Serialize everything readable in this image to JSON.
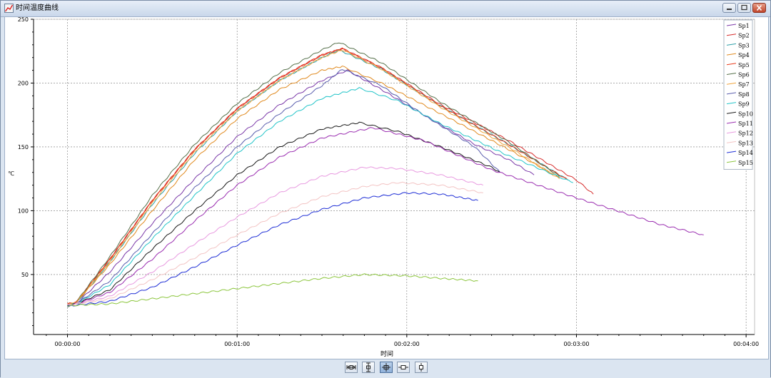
{
  "window": {
    "title": "时间温度曲线"
  },
  "toolbar": {
    "buttons": [
      "fit-horizontal",
      "fit-vertical",
      "fit-both",
      "zoom-horizontal",
      "zoom-vertical"
    ],
    "active": "fit-both"
  },
  "chart_data": {
    "type": "line",
    "title": "",
    "xlabel": "时间",
    "ylabel": "℃",
    "xlim": [
      -0.2,
      4.05
    ],
    "ylim": [
      3,
      250
    ],
    "x_unit": "minutes",
    "x_ticks": [
      0,
      1,
      2,
      3,
      4
    ],
    "x_tick_labels": [
      "00:00:00",
      "00:01:00",
      "00:02:00",
      "00:03:00",
      "00:04:00"
    ],
    "y_ticks": [
      50,
      100,
      150,
      200,
      250
    ],
    "y_tick_labels": [
      "50",
      "100",
      "150",
      "200",
      "250"
    ],
    "grid": true,
    "legend_position": "top-right",
    "series": [
      {
        "name": "Sp1",
        "color": "#7a38a8",
        "x": [
          0,
          0.05,
          0.25,
          0.5,
          0.75,
          1.0,
          1.25,
          1.5,
          1.65,
          1.85,
          2.1,
          2.4,
          2.6,
          2.75
        ],
        "y": [
          26,
          27,
          52,
          90,
          125,
          158,
          183,
          202,
          210,
          195,
          175,
          152,
          140,
          128
        ]
      },
      {
        "name": "Sp2",
        "color": "#d62b2b",
        "x": [
          0,
          0.05,
          0.25,
          0.5,
          0.75,
          1.0,
          1.25,
          1.5,
          1.62,
          1.85,
          2.2,
          2.6,
          3.0,
          3.1
        ],
        "y": [
          27,
          28,
          62,
          108,
          148,
          180,
          204,
          222,
          227,
          212,
          183,
          155,
          124,
          113
        ]
      },
      {
        "name": "Sp3",
        "color": "#2c9fa8",
        "x": [
          0,
          0.05,
          0.25,
          0.5,
          0.75,
          1.0,
          1.25,
          1.5,
          1.6,
          1.85,
          2.2,
          2.6,
          2.95
        ],
        "y": [
          26,
          27,
          60,
          105,
          145,
          178,
          202,
          220,
          226,
          211,
          182,
          152,
          124
        ]
      },
      {
        "name": "Sp4",
        "color": "#e08a1f",
        "x": [
          0,
          0.05,
          0.25,
          0.5,
          0.75,
          1.0,
          1.25,
          1.5,
          1.62,
          1.85,
          2.2,
          2.6,
          2.9
        ],
        "y": [
          26,
          28,
          58,
          100,
          140,
          172,
          195,
          210,
          213,
          200,
          176,
          148,
          126
        ]
      },
      {
        "name": "Sp5",
        "color": "#e83a1a",
        "x": [
          0,
          0.05,
          0.25,
          0.5,
          0.75,
          1.0,
          1.25,
          1.5,
          1.62,
          1.85,
          2.2,
          2.6,
          2.95
        ],
        "y": [
          27,
          28,
          62,
          108,
          148,
          180,
          204,
          222,
          227,
          212,
          182,
          152,
          124
        ]
      },
      {
        "name": "Sp6",
        "color": "#55704a",
        "x": [
          0,
          0.05,
          0.25,
          0.5,
          0.75,
          1.0,
          1.25,
          1.5,
          1.6,
          1.85,
          2.2,
          2.6,
          2.9
        ],
        "y": [
          26,
          28,
          64,
          112,
          152,
          184,
          208,
          226,
          232,
          216,
          185,
          154,
          127
        ]
      },
      {
        "name": "Sp7",
        "color": "#f0a43c",
        "x": [
          0,
          0.05,
          0.25,
          0.5,
          0.75,
          1.0,
          1.25,
          1.5,
          1.62,
          1.85,
          2.2,
          2.6,
          2.9
        ],
        "y": [
          26,
          28,
          60,
          106,
          146,
          178,
          202,
          220,
          226,
          211,
          181,
          150,
          125
        ]
      },
      {
        "name": "Sp8",
        "color": "#5b5fae",
        "x": [
          0,
          0.05,
          0.25,
          0.5,
          0.75,
          1.0,
          1.25,
          1.5,
          1.62,
          1.85,
          2.1,
          2.4,
          2.55
        ],
        "y": [
          25,
          27,
          45,
          82,
          118,
          150,
          176,
          198,
          211,
          198,
          175,
          150,
          130
        ]
      },
      {
        "name": "Sp9",
        "color": "#22c4c8",
        "x": [
          0,
          0.05,
          0.25,
          0.5,
          0.75,
          1.0,
          1.25,
          1.5,
          1.72,
          1.95,
          2.2,
          2.6,
          2.98
        ],
        "y": [
          26,
          27,
          42,
          78,
          112,
          145,
          170,
          188,
          196,
          186,
          168,
          143,
          122
        ]
      },
      {
        "name": "Sp10",
        "color": "#1a1a1a",
        "x": [
          0,
          0.05,
          0.25,
          0.5,
          0.75,
          1.0,
          1.25,
          1.5,
          1.72,
          1.95,
          2.2,
          2.5,
          2.55
        ],
        "y": [
          26,
          27,
          38,
          70,
          100,
          128,
          150,
          164,
          169,
          162,
          150,
          134,
          130
        ]
      },
      {
        "name": "Sp11",
        "color": "#9a2db0",
        "x": [
          0,
          0.05,
          0.25,
          0.5,
          0.75,
          1.0,
          1.25,
          1.5,
          1.8,
          2.1,
          2.5,
          3.0,
          3.5,
          3.75
        ],
        "y": [
          26,
          27,
          36,
          62,
          92,
          120,
          142,
          157,
          165,
          155,
          132,
          110,
          89,
          81
        ]
      },
      {
        "name": "Sp12",
        "color": "#e89ae0",
        "x": [
          0,
          0.05,
          0.25,
          0.5,
          0.75,
          1.0,
          1.25,
          1.5,
          1.75,
          1.95,
          2.2,
          2.45
        ],
        "y": [
          26,
          27,
          33,
          52,
          74,
          95,
          114,
          127,
          134,
          133,
          128,
          120
        ]
      },
      {
        "name": "Sp13",
        "color": "#f3c4c4",
        "x": [
          0,
          0.05,
          0.25,
          0.5,
          0.75,
          1.0,
          1.25,
          1.5,
          1.75,
          1.95,
          2.2,
          2.45
        ],
        "y": [
          26,
          27,
          31,
          46,
          63,
          81,
          98,
          111,
          119,
          122,
          120,
          114
        ]
      },
      {
        "name": "Sp14",
        "color": "#1f2fd6",
        "x": [
          0,
          0.05,
          0.25,
          0.5,
          0.75,
          1.0,
          1.25,
          1.5,
          1.75,
          2.0,
          2.2,
          2.42
        ],
        "y": [
          25,
          26,
          29,
          40,
          56,
          73,
          89,
          101,
          110,
          114,
          113,
          108
        ]
      },
      {
        "name": "Sp15",
        "color": "#8cc63e",
        "x": [
          0,
          0.05,
          0.25,
          0.5,
          0.75,
          1.0,
          1.25,
          1.5,
          1.75,
          2.0,
          2.2,
          2.42
        ],
        "y": [
          25,
          26,
          27,
          31,
          35,
          39,
          43,
          47,
          50,
          49,
          47,
          45
        ]
      }
    ]
  }
}
